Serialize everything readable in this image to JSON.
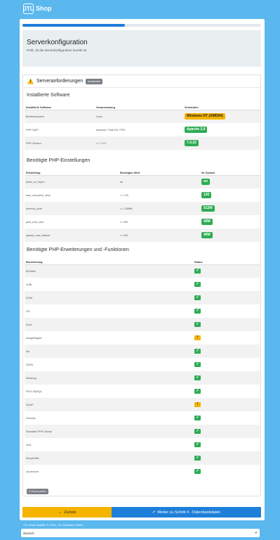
{
  "brand": {
    "logo": "JTL",
    "name": "Shop"
  },
  "progress_percent": 43,
  "hero": {
    "title": "Serverkonfiguration",
    "subtitle": "Prüft, ob die Serverkonfiguration korrekt ist"
  },
  "requirements": {
    "title": "Serveranforderungen",
    "toggle_label": "ausblenden"
  },
  "software": {
    "title": "Installierte Software",
    "headers": [
      "Installierte Software",
      "Voraussetzung",
      "Vorhanden"
    ],
    "rows": [
      {
        "name": "Betriebssystem",
        "req": "Linux",
        "have": "Windows NT (AMD64)",
        "status": "warn"
      },
      {
        "name": "PHP-SAPI",
        "req": "Apache2, FastCGI, FPM",
        "have": "Apache 2.0",
        "status": "ok"
      },
      {
        "name": "PHP-Version",
        "req": ">= 7.3.0",
        "have": "7.3.22",
        "status": "ok"
      }
    ]
  },
  "php_settings": {
    "title": "Benötigte PHP-Einstellungen",
    "headers": [
      "Einstellung",
      "Benötigter Wert",
      "Ihr System"
    ],
    "rows": [
      {
        "name": "allow_url_fopen",
        "req": "an",
        "have": "on"
      },
      {
        "name": "max_execution_time",
        "req": ">= 120",
        "have": "120"
      },
      {
        "name": "memory_limit",
        "req": ">= 128MB",
        "have": "512M"
      },
      {
        "name": "post_max_size",
        "req": ">= 8M",
        "have": "40M"
      },
      {
        "name": "upload_max_filesize",
        "req": ">= 6M",
        "have": "40M"
      }
    ]
  },
  "extensions": {
    "title": "Benötigte PHP-Erweiterungen und -Funktionen",
    "headers": [
      "Bezeichnung",
      "Status"
    ],
    "rows": [
      {
        "name": "BCMath",
        "status": "ok"
      },
      {
        "name": "cURL",
        "status": "ok"
      },
      {
        "name": "DOM",
        "status": "ok"
      },
      {
        "name": "GD",
        "status": "ok"
      },
      {
        "name": "iconv",
        "status": "ok"
      },
      {
        "name": "ImageMagick",
        "status": "warn"
      },
      {
        "name": "intl",
        "status": "ok"
      },
      {
        "name": "JSON",
        "status": "ok"
      },
      {
        "name": "mbstring",
        "status": "ok"
      },
      {
        "name": "PDO::MySQL",
        "status": "ok"
      },
      {
        "name": "SOAP",
        "status": "warn"
      },
      {
        "name": "Sockets",
        "status": "ok"
      },
      {
        "name": "Standard PHP Library",
        "status": "ok"
      },
      {
        "name": "XML",
        "status": "ok"
      },
      {
        "name": "SimpleXML",
        "status": "ok"
      },
      {
        "name": "zip archive",
        "status": "ok"
      }
    ]
  },
  "recheck_label": "Erneut prüfen",
  "nav": {
    "back": "Zurück",
    "next": "Weiter zu Schritt 4 - Datenbankdaten"
  },
  "footer": "JTL-Shop Installer © 2019, JTL-Software-GmbH",
  "language": {
    "selected": "deutsch"
  },
  "colors": {
    "background": "#5bb8ef",
    "accent": "#1e7fd9",
    "ok": "#2eac54",
    "warn": "#f4b400"
  }
}
